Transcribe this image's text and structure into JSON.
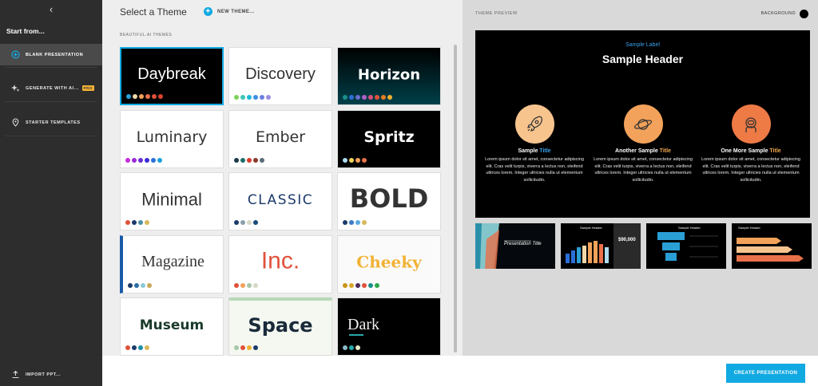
{
  "sidebar": {
    "back_glyph": "‹",
    "start_from": "Start from...",
    "items": [
      {
        "label": "BLANK PRESENTATION",
        "icon": "plus-circle-icon"
      },
      {
        "label": "GENERATE WITH AI...",
        "icon": "sparkle-icon",
        "badge": "PRO"
      },
      {
        "label": "STARTER TEMPLATES",
        "icon": "location-pin-icon"
      }
    ],
    "import_label": "IMPORT PPT..."
  },
  "middle": {
    "title": "Select a Theme",
    "new_theme": "NEW THEME...",
    "section_label": "BEAUTIFUL.AI THEMES"
  },
  "themes": [
    {
      "name": "Daybreak",
      "bg": "#000000",
      "color": "#ffffff",
      "colors": [
        "#2a9fd6",
        "#f0d8a8",
        "#f2a25a",
        "#e8714a",
        "#e0513a",
        "#d9432e"
      ]
    },
    {
      "name": "Discovery",
      "bg": "#ffffff",
      "color": "#333333",
      "colors": [
        "#7cd35a",
        "#3bc6b6",
        "#1fb7d8",
        "#3a8fe0",
        "#6d7fe0",
        "#9a8fe0"
      ]
    },
    {
      "name": "Horizon",
      "bg": "#002a2a",
      "color": "#ffffff",
      "colors": [
        "#1a8f8a",
        "#2a6fd8",
        "#6a6fd0",
        "#b05fc8",
        "#d84f7a",
        "#e0513a",
        "#e67e22",
        "#f2b134"
      ]
    },
    {
      "name": "Luminary",
      "bg": "#ffffff",
      "color": "#333333",
      "colors": [
        "#c72bd8",
        "#9a2bd8",
        "#6a2bd8",
        "#3a2bd8",
        "#2a6fd8",
        "#1a9fd8"
      ]
    },
    {
      "name": "Ember",
      "bg": "#ffffff",
      "color": "#333333",
      "colors": [
        "#1a3a4a",
        "#1a6f6a",
        "#d83a2a",
        "#8a3a2a",
        "#5a6a7a"
      ]
    },
    {
      "name": "Spritz",
      "bg": "#000000",
      "color": "#ffffff",
      "colors": [
        "#aedcf0",
        "#f2d35a",
        "#f2a25a",
        "#e8714a"
      ]
    },
    {
      "name": "Minimal",
      "bg": "#ffffff",
      "color": "#333333",
      "colors": [
        "#e0513a",
        "#1a3a6a",
        "#4a8fa8",
        "#d8b85a"
      ]
    },
    {
      "name": "CLASSIC",
      "bg": "#ffffff",
      "color": "#1a3a6a",
      "colors": [
        "#1a3a6a",
        "#8aa0b0",
        "#d8d8c8",
        "#1a4a7a"
      ]
    },
    {
      "name": "BOLD",
      "bg": "#ffffff",
      "color": "#333333",
      "colors": [
        "#1a3a6a",
        "#3a7ac8",
        "#5aaae0",
        "#d8b85a"
      ]
    },
    {
      "name": "Magazine",
      "bg": "#ffffff",
      "color": "#333333",
      "colors": [
        "#1a3a6a",
        "#2a6fa8",
        "#8acad8",
        "#c8a85a"
      ]
    },
    {
      "name": "Inc.",
      "bg": "#ffffff",
      "color": "#e0513a",
      "colors": [
        "#e0513a",
        "#f2a25a",
        "#a8c8a8",
        "#d8d8c8"
      ]
    },
    {
      "name": "Cheeky",
      "bg": "#fafafa",
      "color": "#f2b134",
      "colors": [
        "#c8941a",
        "#d8a82a",
        "#4a2a5a",
        "#e0513a",
        "#1a8f8a",
        "#2aa84a"
      ]
    },
    {
      "name": "Museum",
      "bg": "#ffffff",
      "color": "#1a3a2a",
      "colors": [
        "#e0513a",
        "#1a3a6a",
        "#1a8fa8",
        "#d8b85a"
      ]
    },
    {
      "name": "Space",
      "bg": "#f4f8f0",
      "color": "#1a2a3a",
      "colors": [
        "#a8c8a8",
        "#e0513a",
        "#f2b134",
        "#1a3a6a"
      ]
    },
    {
      "name": "Dark",
      "bg": "#000000",
      "color": "#eeeeee",
      "colors": [
        "#8ab8c8",
        "#2aa8a8",
        "#e8e8c8"
      ]
    }
  ],
  "preview": {
    "label": "THEME PREVIEW",
    "background_label": "BACKGROUND",
    "slide": {
      "sample_label": "Sample Label",
      "header": "Sample Header",
      "columns": [
        {
          "icon": "rocket-icon",
          "title_a": "Sample ",
          "title_b": "Title",
          "accent": "blue",
          "body": "Lorem ipsum dolor sit amet, consectetur adipiscing elit. Cras velit turpis, viverra a lectus non, eleifend ultrices lorem. Integer ultricies nulla ut elementum sollicitudin."
        },
        {
          "icon": "planet-icon",
          "title_a": "Another Sample ",
          "title_b": "Title",
          "accent": "orange",
          "body": "Lorem ipsum dolor sit amet, consectetur adipiscing elit. Cras velit turpis, viverra a lectus non, eleifend ultrices lorem. Integer ultricies nulla ut elementum sollicitudin."
        },
        {
          "icon": "astronaut-icon",
          "title_a": "One More Sample ",
          "title_b": "Title",
          "accent": "orange",
          "body": "Lorem ipsum dolor sit amet, consectetur adipiscing elit. Cras velit turpis, viverra a lectus non, eleifend ultrices lorem. Integer ultricies nulla ut elementum sollicitudin."
        }
      ]
    },
    "thumbs": {
      "t1_title": "Presentation Title",
      "t2_header": "Sample Header",
      "t2_value": "$90,000",
      "t3_header": "Sample Header",
      "t4_header": "Sample Header"
    }
  },
  "footer": {
    "create_label": "CREATE PRESENTATION"
  },
  "colors": {
    "accent": "#11a9e2",
    "pro_badge": "#f2b134",
    "sidebar_bg": "#2d2d2d"
  }
}
